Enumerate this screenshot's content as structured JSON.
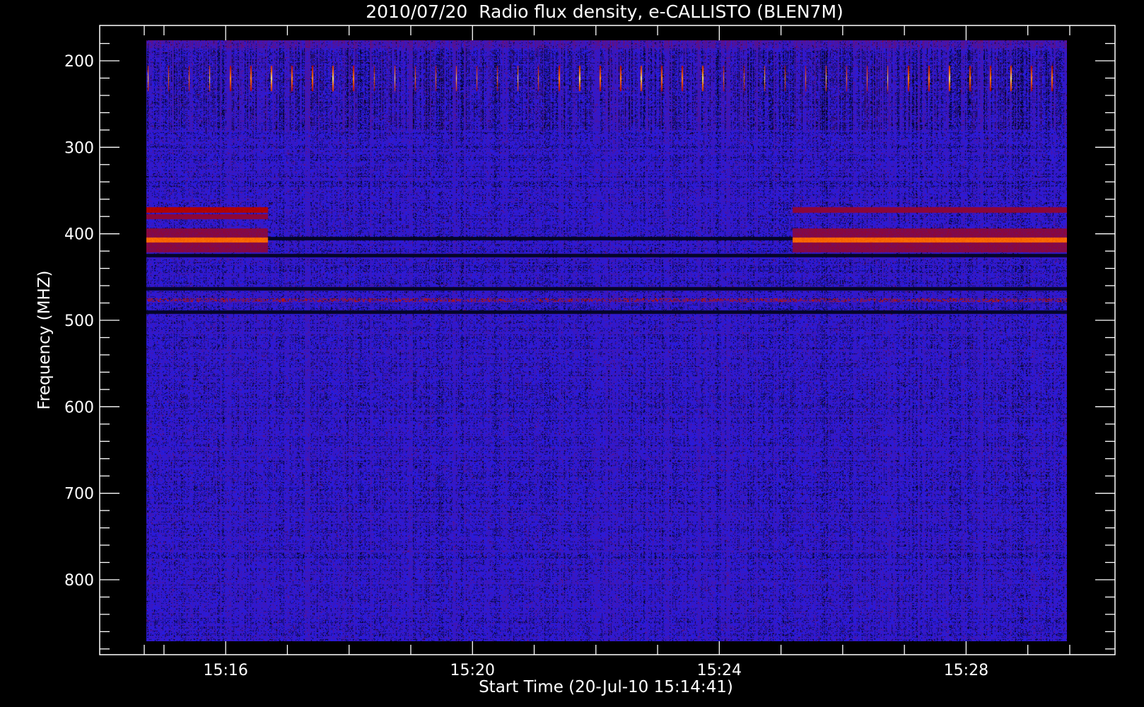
{
  "chart_data": {
    "type": "heatmap",
    "title": "2010/07/20  Radio flux density, e-CALLISTO (BLEN7M)",
    "xlabel": "Start Time (20-Jul-10 15:14:41)",
    "ylabel": "Frequency (MHZ)",
    "x_unit": "minutes after 15:14:41",
    "x_ticks": [
      {
        "label": "15:16",
        "value": 1.32
      },
      {
        "label": "15:20",
        "value": 5.32
      },
      {
        "label": "15:24",
        "value": 9.32
      },
      {
        "label": "15:28",
        "value": 13.32
      }
    ],
    "xlim": [
      0,
      15
    ],
    "y_ticks": [
      200,
      300,
      400,
      500,
      600,
      700,
      800
    ],
    "ylim": [
      880,
      160
    ],
    "y_inverted": true,
    "data_extent": {
      "x": [
        0,
        15
      ],
      "y": [
        180,
        875
      ]
    },
    "colormap": "blue-red-yellow",
    "colors": {
      "background": "#000000",
      "low": "#1d1ef0",
      "mid": "#b00000",
      "high": "#ffff70"
    },
    "features": [
      {
        "kind": "periodic_spikes",
        "freq_range": [
          205,
          235
        ],
        "period_min": 0.333,
        "x_range": [
          0.05,
          14.8
        ]
      },
      {
        "kind": "band",
        "freq": 407,
        "x_range": [
          0,
          2.0
        ],
        "intensity": "high"
      },
      {
        "kind": "band",
        "freq": 372,
        "x_range": [
          0,
          2.0
        ],
        "intensity": "mid"
      },
      {
        "kind": "band",
        "freq": 380,
        "x_range": [
          0,
          2.0
        ],
        "intensity": "low-mid"
      },
      {
        "kind": "band",
        "freq": 407,
        "x_range": [
          10.5,
          15
        ],
        "intensity": "high"
      },
      {
        "kind": "band",
        "freq": 372,
        "x_range": [
          10.5,
          15
        ],
        "intensity": "low-mid"
      },
      {
        "kind": "dark_line",
        "freq": 405,
        "x_range": [
          2.0,
          10.5
        ]
      },
      {
        "kind": "dark_line",
        "freq": 425,
        "x_range": [
          0,
          15
        ]
      },
      {
        "kind": "dark_line",
        "freq": 463,
        "x_range": [
          0,
          15
        ]
      },
      {
        "kind": "speckle_line",
        "freq": 476,
        "x_range": [
          0,
          15
        ]
      },
      {
        "kind": "dark_line",
        "freq": 490,
        "x_range": [
          0,
          15
        ]
      }
    ]
  }
}
